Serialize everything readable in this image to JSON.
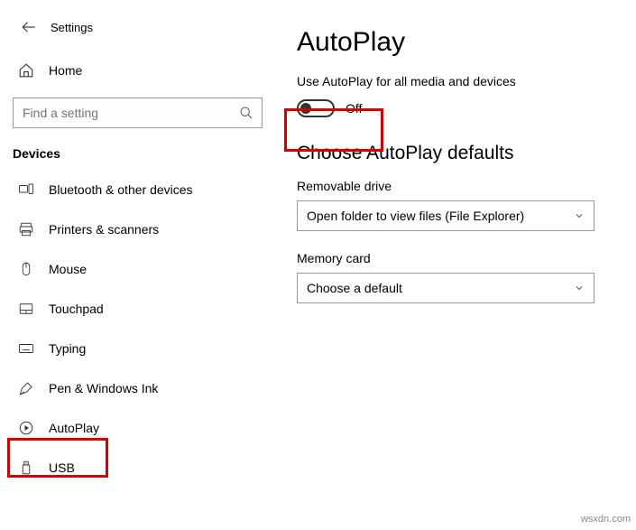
{
  "header": {
    "settings_label": "Settings"
  },
  "home": {
    "label": "Home"
  },
  "search": {
    "placeholder": "Find a setting"
  },
  "section": "Devices",
  "sidebar": {
    "items": [
      {
        "label": "Bluetooth & other devices"
      },
      {
        "label": "Printers & scanners"
      },
      {
        "label": "Mouse"
      },
      {
        "label": "Touchpad"
      },
      {
        "label": "Typing"
      },
      {
        "label": "Pen & Windows Ink"
      },
      {
        "label": "AutoPlay"
      },
      {
        "label": "USB"
      }
    ]
  },
  "main": {
    "title": "AutoPlay",
    "use_autoplay_label": "Use AutoPlay for all media and devices",
    "toggle_state": "Off",
    "defaults_title": "Choose AutoPlay defaults",
    "removable_label": "Removable drive",
    "removable_value": "Open folder to view files (File Explorer)",
    "memorycard_label": "Memory card",
    "memorycard_value": "Choose a default"
  },
  "watermark": "wsxdn.com"
}
